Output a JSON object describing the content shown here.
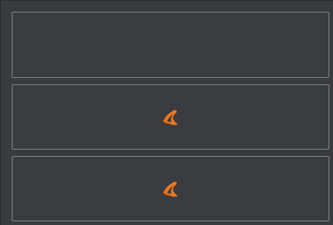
{
  "panels": [
    {
      "id": "panel-1",
      "has_logo": false
    },
    {
      "id": "panel-2",
      "has_logo": true,
      "logo_icon": "orange-curl-logo-icon"
    },
    {
      "id": "panel-3",
      "has_logo": true,
      "logo_icon": "orange-curl-logo-icon"
    }
  ],
  "colors": {
    "background": "#3a3b3f",
    "panel_border": "#7b7c80",
    "logo_primary": "#f07a1a",
    "logo_dark": "#c2520a"
  }
}
